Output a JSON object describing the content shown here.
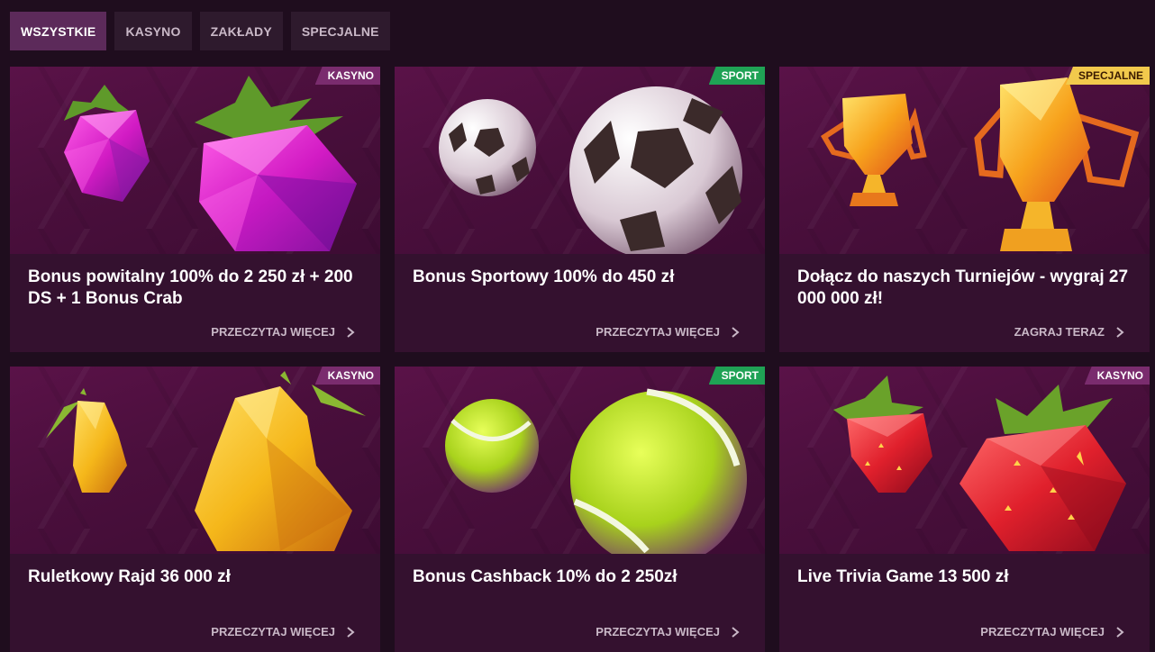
{
  "tabs": [
    {
      "label": "WSZYSTKIE",
      "active": true
    },
    {
      "label": "KASYNO",
      "active": false
    },
    {
      "label": "ZAKŁADY",
      "active": false
    },
    {
      "label": "SPECJALNE",
      "active": false
    }
  ],
  "cards": [
    {
      "badge": "KASYNO",
      "badge_type": "kasyno",
      "art": "raspberry",
      "title": "Bonus powitalny 100% do 2 250 zł + 200 DS + 1 Bonus Crab",
      "link": "PRZECZYTAJ WIĘCEJ"
    },
    {
      "badge": "SPORT",
      "badge_type": "sport",
      "art": "soccer-ball",
      "title": "Bonus Sportowy 100% do 450 zł",
      "link": "PRZECZYTAJ WIĘCEJ"
    },
    {
      "badge": "SPECJALNE",
      "badge_type": "specjalne",
      "art": "trophy",
      "title": "Dołącz do naszych Turniejów - wygraj 27 000 000 zł!",
      "link": "ZAGRAJ TERAZ"
    },
    {
      "badge": "KASYNO",
      "badge_type": "kasyno",
      "art": "pear",
      "title": "Ruletkowy Rajd 36 000 zł",
      "link": "PRZECZYTAJ WIĘCEJ"
    },
    {
      "badge": "SPORT",
      "badge_type": "sport",
      "art": "tennis-ball",
      "title": "Bonus Cashback 10% do 2 250zł",
      "link": "PRZECZYTAJ WIĘCEJ"
    },
    {
      "badge": "KASYNO",
      "badge_type": "kasyno",
      "art": "strawberry",
      "title": "Live Trivia Game 13 500 zł",
      "link": "PRZECZYTAJ WIĘCEJ"
    }
  ],
  "colors": {
    "background": "#1f0d1e",
    "tab": "#2e1a2d",
    "tab_active": "#5c2a5a",
    "card": "#34112f",
    "badge_kasyno": "#7a2c6e",
    "badge_sport": "#1fa255",
    "badge_specjalne": "#f2c94c"
  }
}
